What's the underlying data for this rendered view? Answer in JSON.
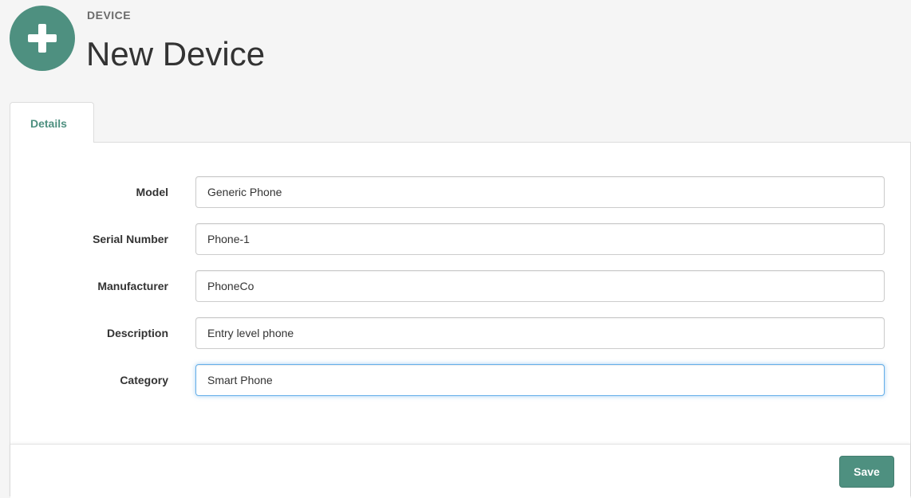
{
  "header": {
    "entity_type": "DEVICE",
    "title": "New Device",
    "icon": "plus-icon",
    "accent_color": "#4e9080"
  },
  "tabs": [
    {
      "label": "Details",
      "active": true
    }
  ],
  "form": {
    "fields": [
      {
        "label": "Model",
        "value": "Generic Phone"
      },
      {
        "label": "Serial Number",
        "value": "Phone-1"
      },
      {
        "label": "Manufacturer",
        "value": "PhoneCo"
      },
      {
        "label": "Description",
        "value": "Entry level phone"
      },
      {
        "label": "Category",
        "value": "Smart Phone",
        "focused": true
      }
    ]
  },
  "footer": {
    "save_label": "Save"
  }
}
